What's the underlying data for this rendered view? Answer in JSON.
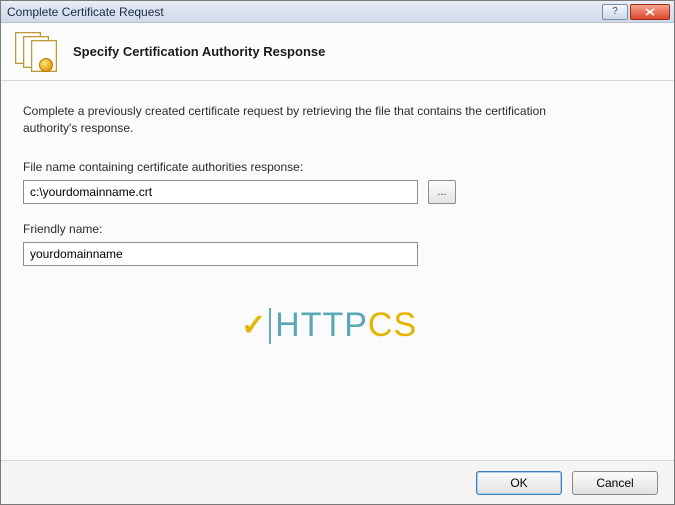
{
  "window": {
    "title": "Complete Certificate Request"
  },
  "header": {
    "title": "Specify Certification Authority Response"
  },
  "content": {
    "description": "Complete a previously created certificate request by retrieving the file that contains the certification authority's response.",
    "file_label": "File name containing certificate authorities response:",
    "file_value": "c:\\yourdomainname.crt",
    "browse_label": "...",
    "friendly_label": "Friendly name:",
    "friendly_value": "yourdomainname"
  },
  "watermark": {
    "part1": "HTTP",
    "part2": "CS"
  },
  "footer": {
    "ok": "OK",
    "cancel": "Cancel"
  }
}
